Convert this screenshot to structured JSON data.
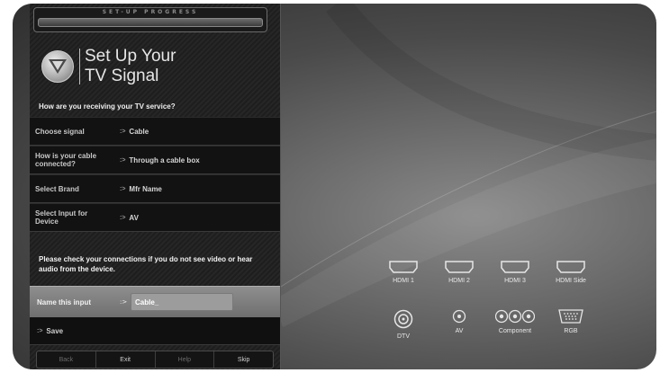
{
  "progress": {
    "label": "SET-UP PROGRESS"
  },
  "header": {
    "title_line1": "Set Up Your",
    "title_line2": "TV Signal",
    "logo_icon": "vizio-v-logo"
  },
  "question": "How are you receiving your TV service?",
  "rows": [
    {
      "label": "Choose signal",
      "value": "Cable"
    },
    {
      "label": "How is your cable connected?",
      "value": "Through a cable box"
    },
    {
      "label": "Select Brand",
      "value": "Mfr Name"
    },
    {
      "label": "Select Input for Device",
      "value": "AV"
    }
  ],
  "notice": "Please check your connections if you do not see video or hear audio from the device.",
  "name_input": {
    "label": "Name this input",
    "value": "Cable_"
  },
  "save_label": "Save",
  "buttons": {
    "back": "Back",
    "exit": "Exit",
    "help": "Help",
    "skip": "Skip"
  },
  "inputs": [
    {
      "label": "HDMI 1",
      "icon": "hdmi-icon"
    },
    {
      "label": "HDMI 2",
      "icon": "hdmi-icon"
    },
    {
      "label": "HDMI 3",
      "icon": "hdmi-icon"
    },
    {
      "label": "HDMI Side",
      "icon": "hdmi-icon"
    },
    {
      "label": "DTV",
      "icon": "coax-icon"
    },
    {
      "label": "AV",
      "icon": "rca-icon"
    },
    {
      "label": "Component",
      "icon": "component-icon"
    },
    {
      "label": "RGB",
      "icon": "vga-icon"
    }
  ]
}
